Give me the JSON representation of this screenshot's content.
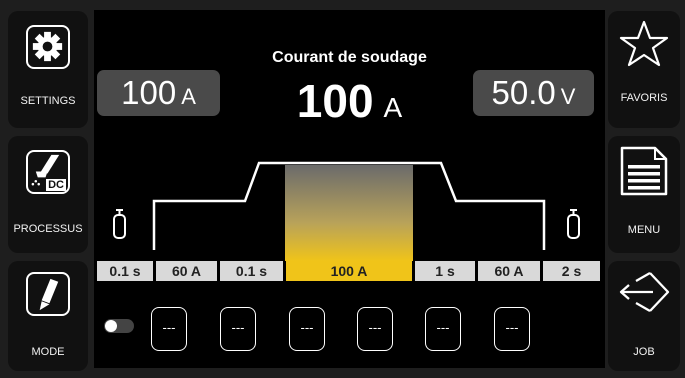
{
  "left_panel": {
    "settings_label": "SETTINGS",
    "process_label": "PROCESSUS",
    "process_badge": "DC",
    "mode_label": "MODE"
  },
  "right_panel": {
    "favorites_label": "FAVORIS",
    "menu_label": "MENU",
    "job_label": "JOB"
  },
  "main": {
    "title": "Courant de soudage",
    "current_value": "100",
    "current_unit": "A",
    "left_readout_value": "100",
    "left_readout_unit": "A",
    "right_readout_value": "50.0",
    "right_readout_unit": "V"
  },
  "sequence": {
    "segments": [
      "0.1 s",
      "60 A",
      "0.1 s",
      "100 A",
      "1 s",
      "60 A",
      "2 s"
    ],
    "active_index": 3
  },
  "jobs": {
    "slots": [
      "---",
      "---",
      "---",
      "---",
      "---",
      "---"
    ]
  },
  "colors": {
    "accent": "#f0c419",
    "panel": "#111111",
    "readout": "#4a4a4a"
  }
}
